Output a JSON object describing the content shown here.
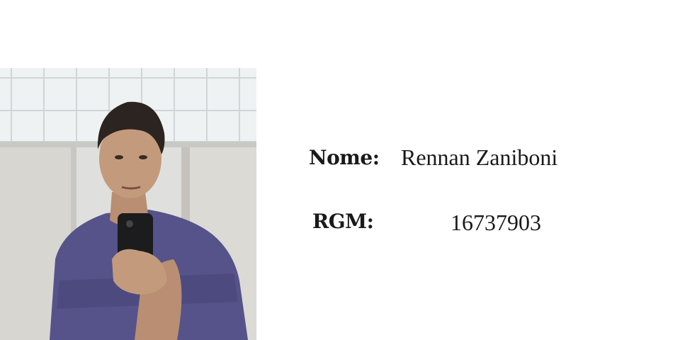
{
  "photo": {
    "description_icon": "profile-photo"
  },
  "fields": {
    "name_label": "Nome:",
    "name_value": "Rennan Zaniboni",
    "rgm_label": "RGM:",
    "rgm_value": "16737903"
  },
  "colors": {
    "text": "#1a1a1a",
    "background": "#ffffff",
    "shirt": "#56538a"
  }
}
